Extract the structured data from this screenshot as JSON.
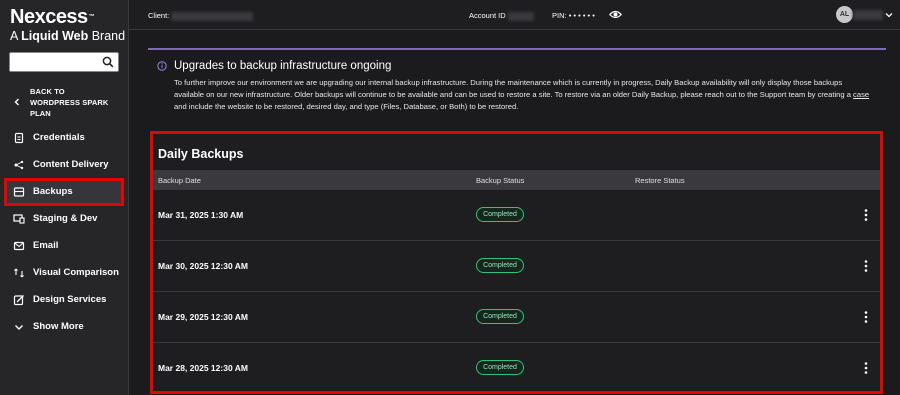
{
  "brand": {
    "name": "Nexcess",
    "tm": "™",
    "sub_prefix": "A ",
    "sub_bold": "Liquid Web",
    "sub_suffix": " Brand"
  },
  "sidebar": {
    "search_placeholder": "",
    "back_label_line1": "BACK TO",
    "back_label_line2": "WORDPRESS SPARK",
    "back_label_line3": "PLAN",
    "items": [
      {
        "label": "Credentials",
        "icon": "credentials-icon"
      },
      {
        "label": "Content Delivery",
        "icon": "content-delivery-icon"
      },
      {
        "label": "Backups",
        "icon": "backups-icon"
      },
      {
        "label": "Staging & Dev",
        "icon": "staging-icon"
      },
      {
        "label": "Email",
        "icon": "email-icon"
      },
      {
        "label": "Visual Comparison",
        "icon": "visual-comparison-icon"
      },
      {
        "label": "Design Services",
        "icon": "design-services-icon"
      },
      {
        "label": "Show More",
        "icon": "chevron-down-icon"
      }
    ]
  },
  "topbar": {
    "client_label": "Client:",
    "account_label": "Account ID",
    "pin_label": "PIN:",
    "pin_value": "• • • • • •",
    "avatar_initials": "AL"
  },
  "notice": {
    "title": "Upgrades to backup infrastructure ongoing",
    "body_part1": "To further improve our environment we are upgrading our internal backup infrastructure. During the maintenance which is currently in progress, Daily Backup availability will only display those backups available on our new infrastructure. Older backups will continue to be available and can be used to restore a site. To restore via an older Daily Backup, please reach out to the Support team by creating a ",
    "link_text": "case",
    "body_part2": " and include the website to be restored, desired day, and type (Files, Database, or Both) to be restored."
  },
  "backups": {
    "title": "Daily Backups",
    "columns": {
      "date": "Backup Date",
      "status": "Backup Status",
      "restore": "Restore Status"
    },
    "rows": [
      {
        "date": "Mar 31, 2025 1:30 AM",
        "status": "Completed",
        "restore": ""
      },
      {
        "date": "Mar 30, 2025 12:30 AM",
        "status": "Completed",
        "restore": ""
      },
      {
        "date": "Mar 29, 2025 12:30 AM",
        "status": "Completed",
        "restore": ""
      },
      {
        "date": "Mar 28, 2025 12:30 AM",
        "status": "Completed",
        "restore": ""
      }
    ]
  },
  "colors": {
    "highlight": "#e10600",
    "accent_purple": "#7e6bb8",
    "badge_green": "#2ec47a"
  }
}
